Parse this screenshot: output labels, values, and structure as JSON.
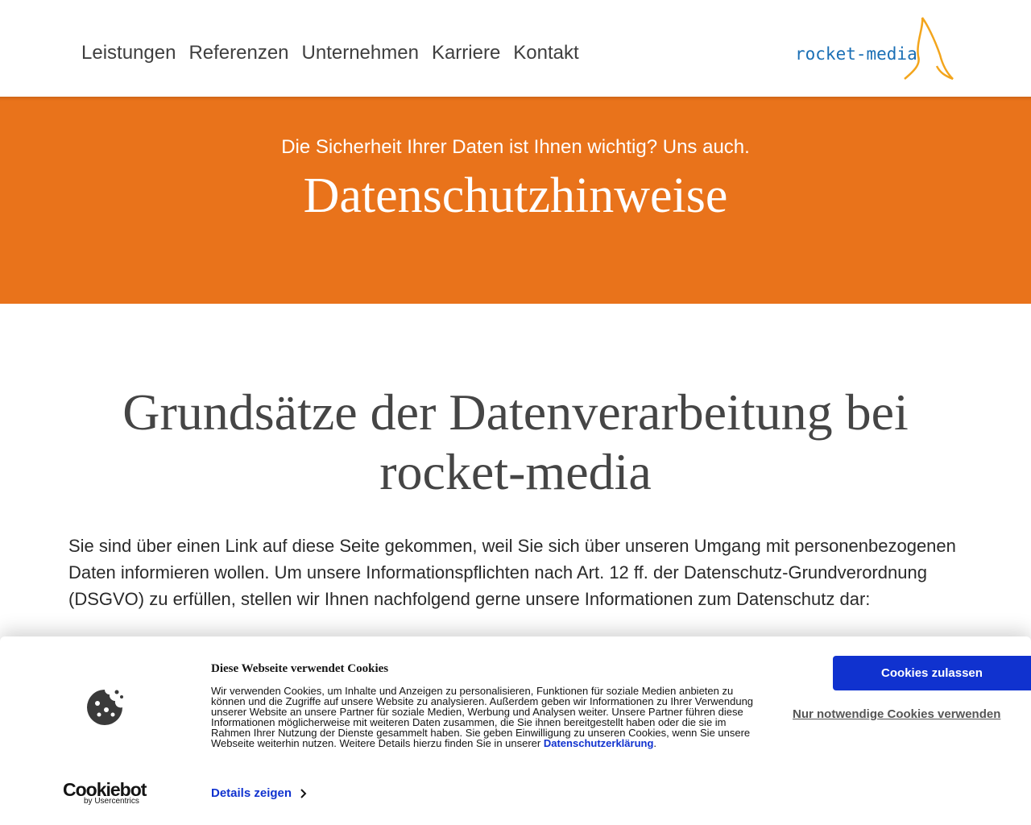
{
  "nav": {
    "items": [
      "Leistungen",
      "Referenzen",
      "Unternehmen",
      "Karriere",
      "Kontakt"
    ]
  },
  "logo": {
    "text": "rocket-media"
  },
  "hero": {
    "tagline": "Die Sicherheit Ihrer Daten ist Ihnen wichtig? Uns auch.",
    "title": "Datenschutzhinweise"
  },
  "main": {
    "heading": "Grundsätze der Datenverarbeitung bei rocket-media",
    "intro": "Sie sind über einen Link auf diese Seite gekommen, weil Sie sich über unseren Umgang mit personenbezogenen Daten informieren wollen. Um unsere Informationspflichten nach Art. 12 ff. der Datenschutz-Grundverordnung (DSGVO) zu erfüllen, stellen wir Ihnen nachfolgend gerne unsere Informationen zum Datenschutz dar:"
  },
  "cookie_banner": {
    "title": "Diese Webseite verwendet Cookies",
    "text": "Wir verwenden Cookies, um Inhalte und Anzeigen zu personalisieren, Funktionen für soziale Medien anbieten zu können und die Zugriffe auf unsere Website zu analysieren. Außerdem geben wir Informationen zu Ihrer Verwendung unserer Website an unsere Partner für soziale Medien, Werbung und Analysen weiter. Unsere Partner führen diese Informationen möglicherweise mit weiteren Daten zusammen, die Sie ihnen bereitgestellt haben oder die sie im Rahmen Ihrer Nutzung der Dienste gesammelt haben. Sie geben Einwilligung zu unseren Cookies, wenn Sie unsere Webseite weiterhin nutzen. Weitere Details hierzu finden Sie in unserer ",
    "privacy_link": "Datenschutzerklärung",
    "text_end": ".",
    "details_label": "Details zeigen",
    "allow_label": "Cookies zulassen",
    "necessary_label": "Nur notwendige Cookies verwenden",
    "brand": "Cookiebot",
    "brand_sub": "by Usercentrics"
  },
  "colors": {
    "accent_orange": "#e9731b",
    "primary_blue": "#1032cf",
    "logo_blue": "#1a6fb5",
    "logo_orange": "#f3a51c"
  }
}
